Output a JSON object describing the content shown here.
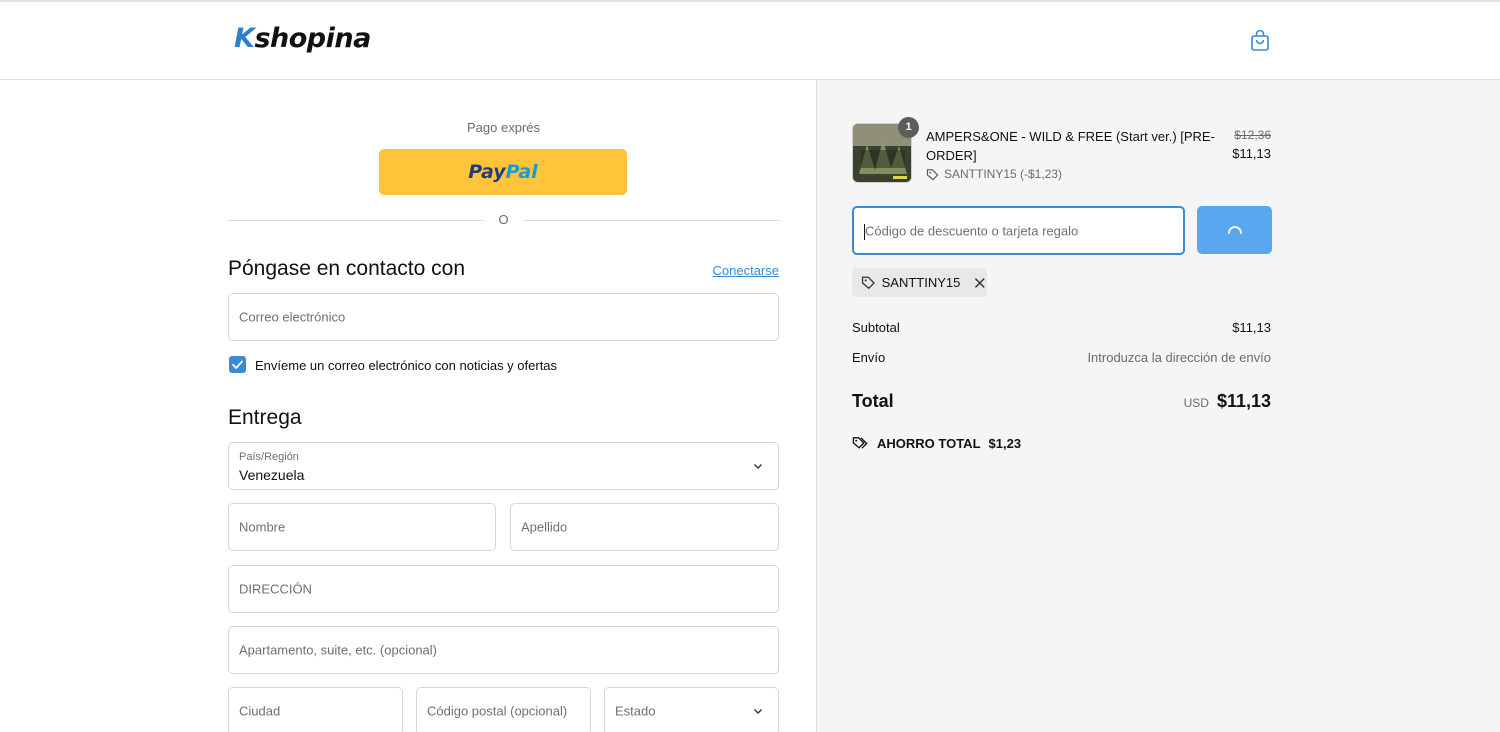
{
  "header": {
    "logo_k": "K",
    "logo_rest": "shopina",
    "cart_icon": "shopping-bag-icon"
  },
  "express": {
    "label": "Pago exprés",
    "paypal_pay": "Pay",
    "paypal_pal": "Pal",
    "divider_text": "O"
  },
  "contact": {
    "title": "Póngase en contacto con",
    "login_link": "Conectarse",
    "email_placeholder": "Correo electrónico",
    "newsletter_label": "Envíeme un correo electrónico con noticias y ofertas",
    "newsletter_checked": true
  },
  "delivery": {
    "title": "Entrega",
    "country_label": "País/Región",
    "country_value": "Venezuela",
    "first_name_placeholder": "Nombre",
    "last_name_placeholder": "Apellido",
    "address_placeholder": "DIRECCIÓN",
    "apartment_placeholder": "Apartamento, suite, etc. (opcional)",
    "city_placeholder": "Ciudad",
    "postal_placeholder": "Código postal (opcional)",
    "state_placeholder": "Estado"
  },
  "order": {
    "item": {
      "quantity": "1",
      "name": "AMPERS&ONE - WILD & FREE (Start ver.) [PRE-ORDER]",
      "discount_line": "SANTTINY15 (-$1,23)",
      "old_price": "$12,36",
      "new_price": "$11,13"
    },
    "discount_placeholder": "Código de descuento o tarjeta regalo",
    "applied_code": "SANTTINY15",
    "subtotal_label": "Subtotal",
    "subtotal_value": "$11,13",
    "shipping_label": "Envío",
    "shipping_value": "Introduzca la dirección de envío",
    "total_label": "Total",
    "total_currency": "USD",
    "total_value": "$11,13",
    "savings_label": "AHORRO TOTAL",
    "savings_value": "$1,23"
  },
  "colors": {
    "accent": "#3a8ad6",
    "paypal_yellow": "#ffc439",
    "apply_button": "#5aa6ef"
  }
}
